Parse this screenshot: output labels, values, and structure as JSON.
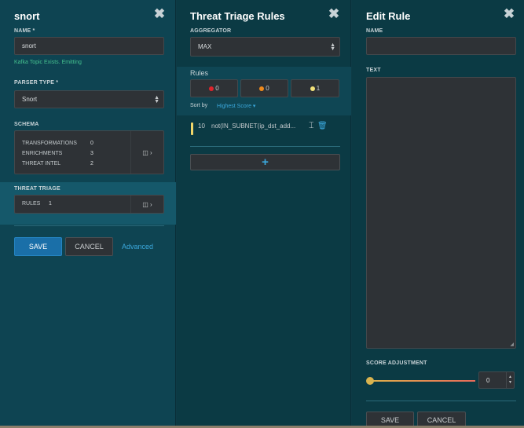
{
  "parser_panel": {
    "title": "snort",
    "name_label": "NAME *",
    "name_value": "snort",
    "kafka_status": "Kafka Topic Exists. Emitting",
    "parser_type_label": "PARSER TYPE *",
    "parser_type_value": "Snort",
    "schema_label": "SCHEMA",
    "schema_rows": [
      {
        "key": "TRANSFORMATIONS",
        "value": "0"
      },
      {
        "key": "ENRICHMENTS",
        "value": "3"
      },
      {
        "key": "THREAT INTEL",
        "value": "2"
      }
    ],
    "threat_triage_label": "THREAT TRIAGE",
    "rules_key": "RULES",
    "rules_value": "1",
    "save_label": "SAVE",
    "cancel_label": "CANCEL",
    "advanced_label": "Advanced"
  },
  "triage_panel": {
    "title": "Threat Triage Rules",
    "aggregator_label": "AGGREGATOR",
    "aggregator_value": "MAX",
    "rules_label": "Rules",
    "severity_filters": [
      {
        "color": "#e0242c",
        "count": "0"
      },
      {
        "color": "#f08a1c",
        "count": "0"
      },
      {
        "color": "#f2e27a",
        "count": "1"
      }
    ],
    "sort_by_label": "Sort by",
    "sort_by_value": "Highest Score ▾",
    "rule_score": "10",
    "rule_text": "not(IN_SUBNET(ip_dst_add..."
  },
  "edit_panel": {
    "title": "Edit Rule",
    "name_label": "NAME",
    "name_value": "",
    "text_label": "TEXT",
    "text_value": "",
    "score_label": "SCORE ADJUSTMENT",
    "score_value": "0",
    "save_label": "SAVE",
    "cancel_label": "CANCEL"
  },
  "colors": {
    "accent_blue": "#1a6fa8",
    "link_blue": "#3ba8dc",
    "success_green": "#45c08e"
  }
}
